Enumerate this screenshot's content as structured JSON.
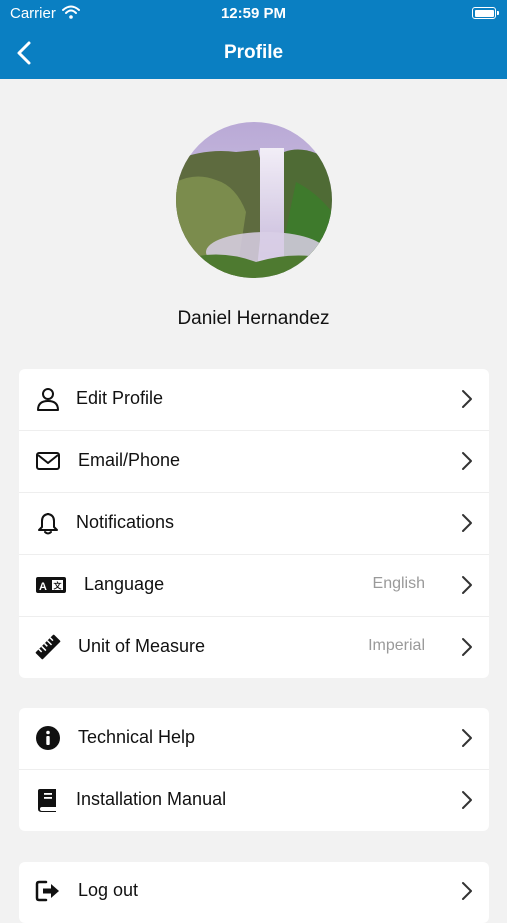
{
  "status_bar": {
    "carrier": "Carrier",
    "time": "12:59 PM"
  },
  "header": {
    "title": "Profile"
  },
  "user": {
    "name": "Daniel Hernandez"
  },
  "settings_group": [
    {
      "label": "Edit Profile",
      "value": ""
    },
    {
      "label": "Email/Phone",
      "value": ""
    },
    {
      "label": "Notifications",
      "value": ""
    },
    {
      "label": "Language",
      "value": "English"
    },
    {
      "label": "Unit of Measure",
      "value": "Imperial"
    }
  ],
  "help_group": [
    {
      "label": "Technical Help"
    },
    {
      "label": "Installation Manual"
    }
  ],
  "account_group": [
    {
      "label": "Log out"
    }
  ],
  "colors": {
    "header": "#0a7fc2",
    "background": "#f2f2f2",
    "value_text": "#9a9a9a"
  }
}
